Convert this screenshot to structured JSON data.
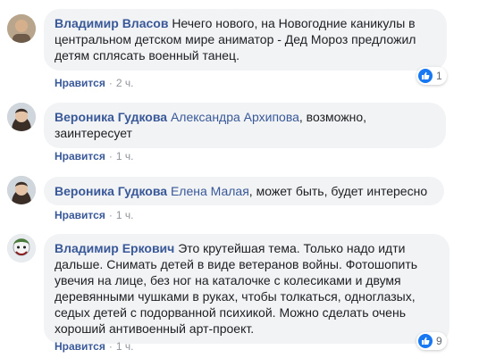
{
  "comments": [
    {
      "author": "Владимир Власов",
      "mention": "",
      "text": "Нечего нового, на Новогодние каникулы в центральном детском мире аниматор - Дед Мороз предложил детям сплясать военный танец.",
      "like_label": "Нравится",
      "time": "2 ч.",
      "reactions": "1"
    },
    {
      "author": "Вероника Гудкова",
      "mention": "Александра Архипова",
      "text": ", возможно, заинтересует",
      "like_label": "Нравится",
      "time": "1 ч."
    },
    {
      "author": "Вероника Гудкова",
      "mention": "Елена Малая",
      "text": ", может быть, будет интересно",
      "like_label": "Нравится",
      "time": "1 ч."
    },
    {
      "author": "Владимир Еркович",
      "mention": "",
      "text": "Это крутейшая тема. Только надо идти дальше. Снимать детей в виде ветеранов войны. Фотошопить увечия на лице, без ног на каталочке с колесиками и двумя деревянными чушками в руках, чтобы толкаться, одноглазых, седых детей с подорванной психикой. Можно сделать очень хороший антивоенный арт-проект.",
      "like_label": "Нравится",
      "time": "1 ч.",
      "reactions": "9"
    }
  ],
  "colors": {
    "link": "#385898",
    "bubble": "#f2f3f5",
    "like_blue": "#1877f2"
  },
  "icons": {
    "reaction": "like-thumb-icon"
  }
}
